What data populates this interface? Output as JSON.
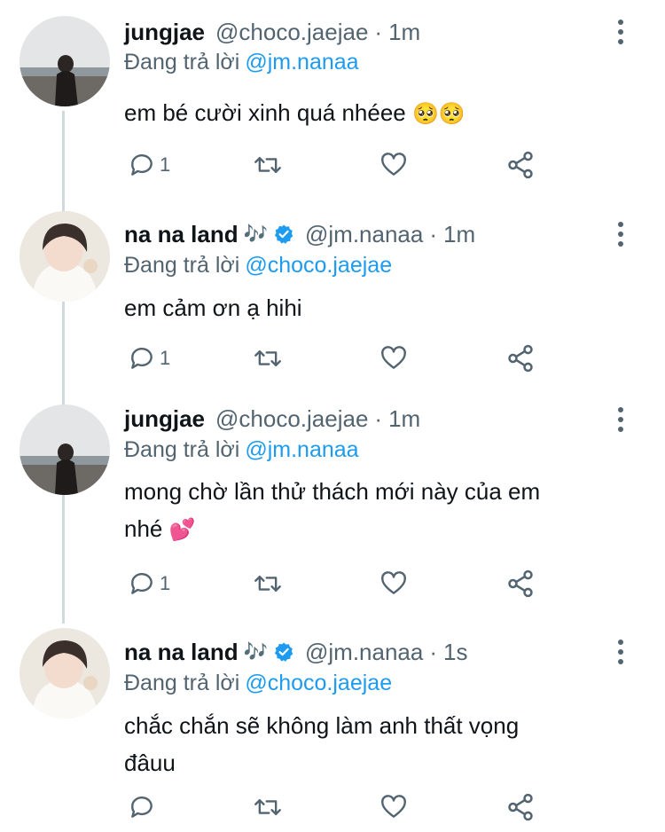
{
  "tweets": [
    {
      "name": "jungjae",
      "handle": "@choco.jaejae",
      "time": "1m",
      "replying_label": "Đang trả lời",
      "replying_to": "@jm.nanaa",
      "text": "em bé cười xinh quá nhéee",
      "emoji": "🥺🥺",
      "reply_count": "1",
      "verified": false
    },
    {
      "name": "na na land",
      "name_emoji": "🎶",
      "handle": "@jm.nanaa",
      "time": "1m",
      "replying_label": "Đang trả lời",
      "replying_to": "@choco.jaejae",
      "text": "em cảm ơn ạ hihi",
      "reply_count": "1",
      "verified": true
    },
    {
      "name": "jungjae",
      "handle": "@choco.jaejae",
      "time": "1m",
      "replying_label": "Đang trả lời",
      "replying_to": "@jm.nanaa",
      "text_line1": "mong chờ lần thử thách mới này của em",
      "text_line2": "nhé",
      "emoji": "💕",
      "reply_count": "1",
      "verified": false
    },
    {
      "name": "na na land",
      "name_emoji": "🎶",
      "handle": "@jm.nanaa",
      "time": "1s",
      "replying_label": "Đang trả lời",
      "replying_to": "@choco.jaejae",
      "text_line1": "chắc chắn sẽ không làm anh thất vọng",
      "text_line2": "đâuu",
      "reply_count": "",
      "verified": true
    }
  ],
  "icons": {
    "reply": "reply-icon",
    "retweet": "retweet-icon",
    "like": "like-icon",
    "share": "share-icon",
    "more": "more-options-icon",
    "verified": "verified-badge-icon"
  },
  "colors": {
    "link": "#1d9bf0",
    "secondary_text": "#536471",
    "primary_text": "#0f1419",
    "thread_line": "#cfd9de"
  }
}
